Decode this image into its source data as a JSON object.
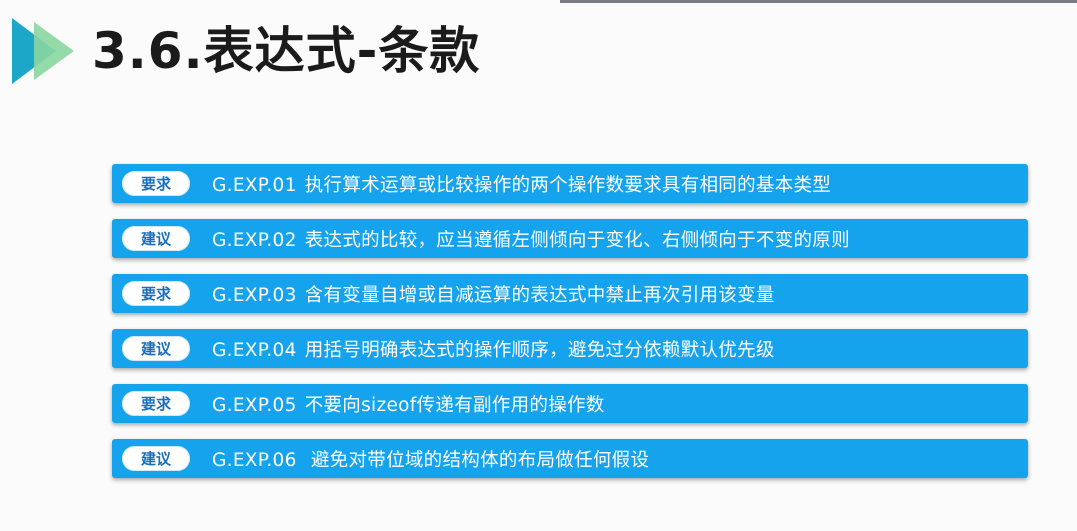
{
  "header": {
    "title": "3.6.表达式-条款"
  },
  "colors": {
    "row_bg": "#16a3ee",
    "badge_bg": "#ffffff",
    "badge_text": "#1a6fbd",
    "title_text": "#1b1b1b",
    "logo_dark": "#1ca6c8",
    "logo_light": "#8ad6a0"
  },
  "rules": [
    {
      "badge": "要求",
      "code": "G.EXP.01",
      "text": "执行算术运算或比较操作的两个操作数要求具有相同的基本类型"
    },
    {
      "badge": "建议",
      "code": "G.EXP.02",
      "text": "表达式的比较，应当遵循左侧倾向于变化、右侧倾向于不变的原则"
    },
    {
      "badge": "要求",
      "code": "G.EXP.03",
      "text": "含有变量自增或自减运算的表达式中禁止再次引用该变量"
    },
    {
      "badge": "建议",
      "code": "G.EXP.04",
      "text": "用括号明确表达式的操作顺序，避免过分依赖默认优先级"
    },
    {
      "badge": "要求",
      "code": "G.EXP.05",
      "text": "不要向sizeof传递有副作用的操作数"
    },
    {
      "badge": "建议",
      "code": "G.EXP.06",
      "text": " 避免对带位域的结构体的布局做任何假设"
    }
  ]
}
